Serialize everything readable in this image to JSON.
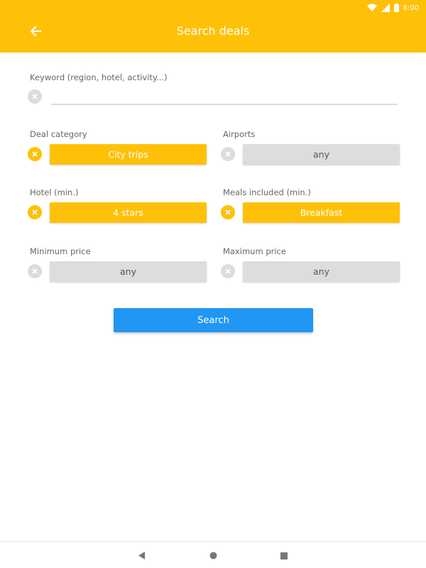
{
  "status_bar": {
    "time": "8:00"
  },
  "app_bar": {
    "title": "Search deals",
    "back_icon": "arrow-left-icon",
    "color": "#FFC107"
  },
  "keyword": {
    "label": "Keyword (region, hotel, activity...)",
    "value": "",
    "clear_active": false
  },
  "filters": {
    "deal_category": {
      "label": "Deal category",
      "value": "City trips",
      "active": true
    },
    "airports": {
      "label": "Airports",
      "value": "any",
      "active": false
    },
    "hotel_min": {
      "label": "Hotel (min.)",
      "value": "4 stars",
      "active": true
    },
    "meals_included": {
      "label": "Meals included (min.)",
      "value": "Breakfast",
      "active": true
    },
    "minimum_price": {
      "label": "Minimum price",
      "value": "any",
      "active": false
    },
    "maximum_price": {
      "label": "Maximum price",
      "value": "any",
      "active": false
    }
  },
  "search_button": {
    "label": "Search",
    "color": "#2196F3"
  },
  "nav_bar": {
    "back_icon": "nav-back-icon",
    "home_icon": "nav-home-icon",
    "recents_icon": "nav-recents-icon"
  }
}
